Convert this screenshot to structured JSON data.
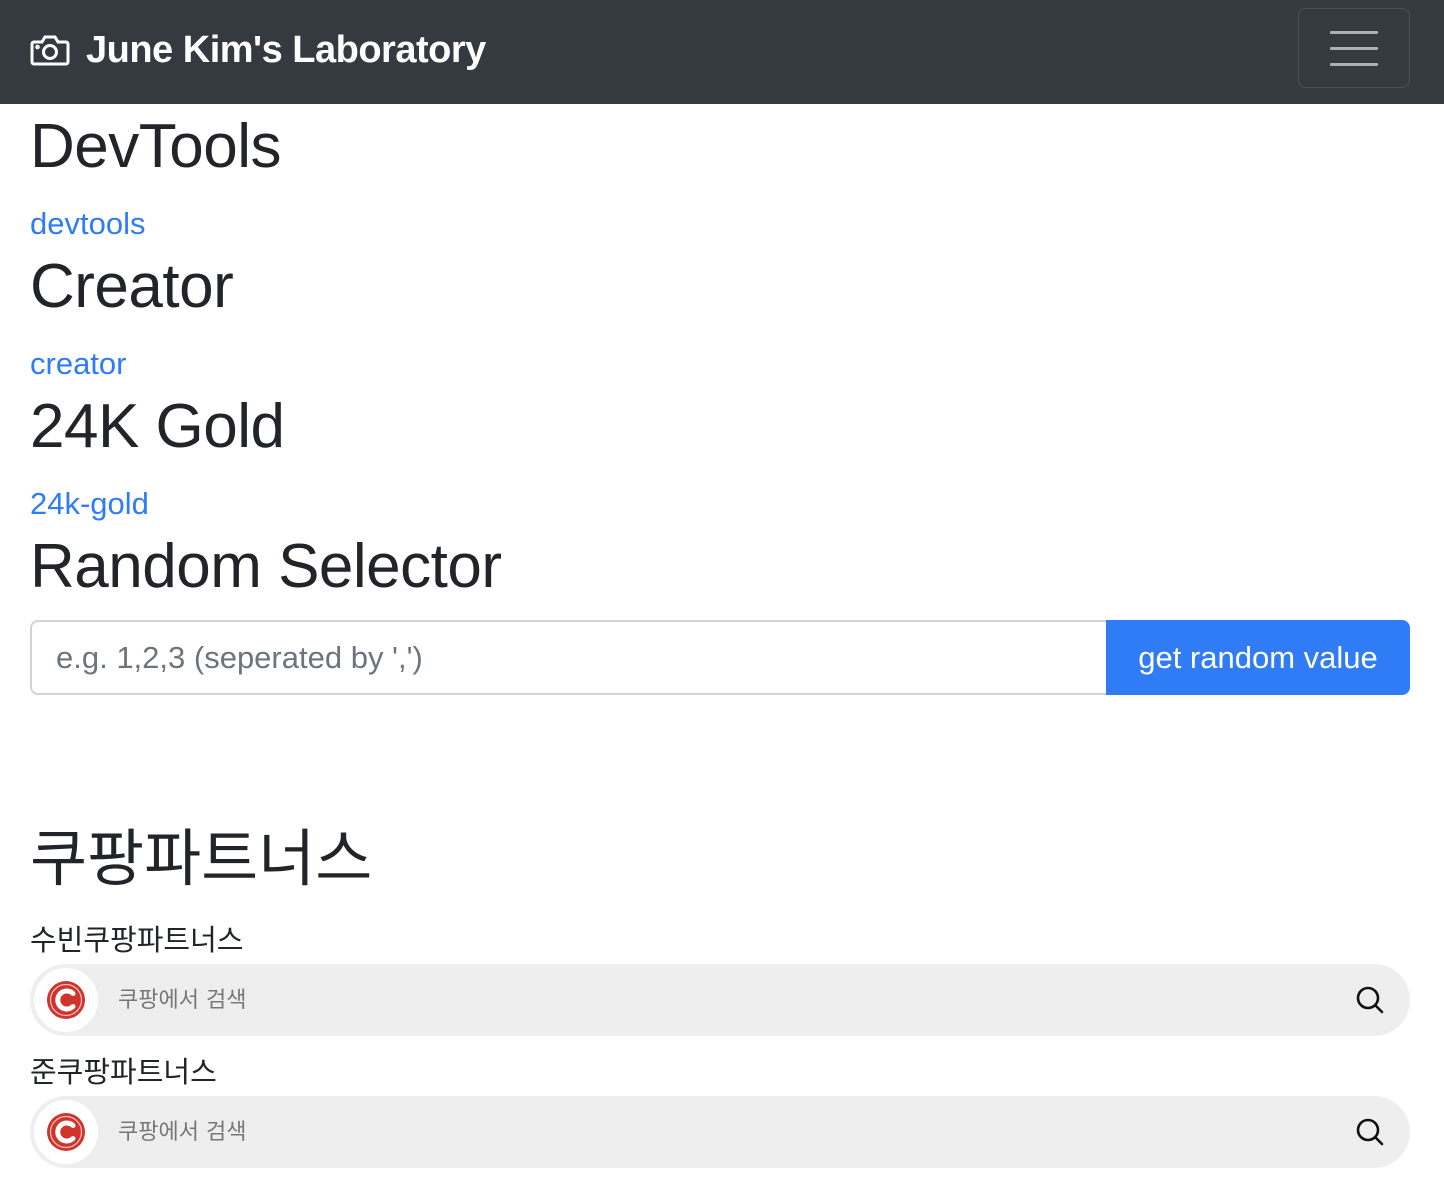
{
  "navbar": {
    "brand": "June Kim's Laboratory",
    "brand_icon": "camera-icon",
    "toggler_icon": "hamburger-menu-icon"
  },
  "sections": [
    {
      "heading": "DevTools",
      "link": "devtools"
    },
    {
      "heading": "Creator",
      "link": "creator"
    },
    {
      "heading": "24K Gold",
      "link": "24k-gold"
    }
  ],
  "random_selector": {
    "heading": "Random Selector",
    "placeholder": "e.g. 1,2,3 (seperated by ',')",
    "button_label": "get random value"
  },
  "coupang": {
    "heading": "쿠팡파트너스",
    "widgets": [
      {
        "label": "수빈쿠팡파트너스",
        "placeholder": "쿠팡에서 검색",
        "logo_icon": "coupang-logo-icon",
        "search_icon": "search-icon"
      },
      {
        "label": "준쿠팡파트너스",
        "placeholder": "쿠팡에서 검색",
        "logo_icon": "coupang-logo-icon",
        "search_icon": "search-icon"
      }
    ]
  },
  "colors": {
    "navbar_bg": "#343a40",
    "link": "#2f7cf6",
    "primary_button": "#2f7cf6",
    "coupang_red": "#d0342c"
  }
}
